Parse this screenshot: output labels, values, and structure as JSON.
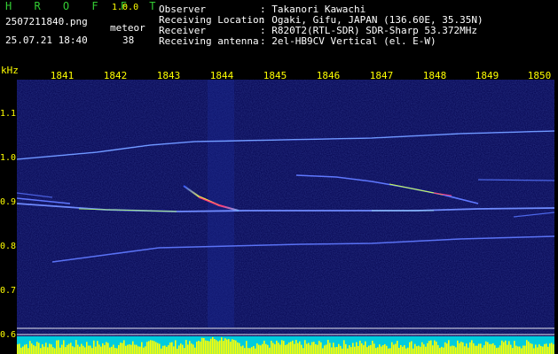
{
  "header": {
    "app_name": "H R O F F T",
    "version": "1.0.0",
    "filename": "2507211840.png",
    "datetime": "25.07.21 18:40",
    "count_label": "meteor",
    "count_value": "38",
    "info_labels": [
      "Observer",
      "Receiving Location",
      "Receiver",
      "Receiving antenna"
    ],
    "info_values": [
      ": Takanori Kawachi",
      ": Ogaki, Gifu, JAPAN (136.60E, 35.35N)",
      ": R820T2(RTL-SDR) SDR-Sharp 53.372MHz",
      ": 2el-HB9CV Vertical (el. E-W)"
    ]
  },
  "axis": {
    "unit": "kHz",
    "x_ticks": [
      "1841",
      "1842",
      "1843",
      "1844",
      "1845",
      "1846",
      "1847",
      "1848",
      "1849",
      "1850"
    ],
    "y_ticks": [
      "1.1",
      "1.0",
      "0.9",
      "0.8",
      "0.7",
      "0.6"
    ]
  },
  "colors": {
    "background": "#00004a",
    "trace": "#5f78ff",
    "text_white": "#ffffff",
    "text_green": "#33cc33",
    "text_yellow": "#ffff00",
    "meteor_head": "#ff3b7a",
    "meteor_mid": "#ffff33"
  }
}
